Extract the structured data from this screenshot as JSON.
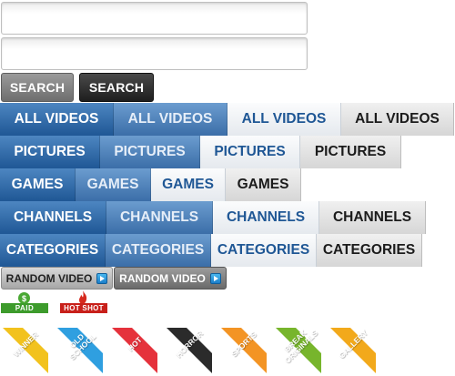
{
  "search": {
    "input1_value": "",
    "input2_value": "",
    "button_a_label": "SEARCH",
    "button_b_label": "SEARCH"
  },
  "nav_rows": [
    {
      "name": "all-videos",
      "labels": [
        "ALL VIDEOS",
        "ALL VIDEOS",
        "ALL VIDEOS",
        "ALL VIDEOS"
      ]
    },
    {
      "name": "pictures",
      "labels": [
        "PICTURES",
        "PICTURES",
        "PICTURES",
        "PICTURES"
      ]
    },
    {
      "name": "games",
      "labels": [
        "GAMES",
        "GAMES",
        "GAMES",
        "GAMES"
      ]
    },
    {
      "name": "channels",
      "labels": [
        "CHANNELS",
        "CHANNELS",
        "CHANNELS",
        "CHANNELS"
      ]
    },
    {
      "name": "categories",
      "labels": [
        "CATEGORIES",
        "CATEGORIES",
        "CATEGORIES",
        "CATEGORIES"
      ]
    }
  ],
  "random_video": {
    "button_a_label": "RANDOM VIDEO",
    "button_b_label": "RANDOM VIDEO",
    "icon": "play-icon"
  },
  "badges": {
    "paid_label": "PAID",
    "paid_icon_text": "$",
    "paid_color": "#3d9b2c",
    "hot_label": "HOT SHOT",
    "hot_color": "#c8201a",
    "hot_icon": "flame-icon"
  },
  "ribbons": [
    {
      "name": "winner",
      "label": "WINNER",
      "color": "#f2c21d"
    },
    {
      "name": "old-school",
      "label": "OLD\nSCHOOL",
      "color": "#2f9fe0"
    },
    {
      "name": "hot",
      "label": "HOT",
      "color": "#e5323c"
    },
    {
      "name": "horror",
      "label": "HORROR",
      "color": "#2b2b2b"
    },
    {
      "name": "sports",
      "label": "SPORTS",
      "color": "#f39424"
    },
    {
      "name": "break-originals",
      "label": "BREAK\nORIGINALS",
      "color": "#77b52c"
    },
    {
      "name": "gallery",
      "label": "GALLERY",
      "color": "#f2a91b"
    }
  ]
}
